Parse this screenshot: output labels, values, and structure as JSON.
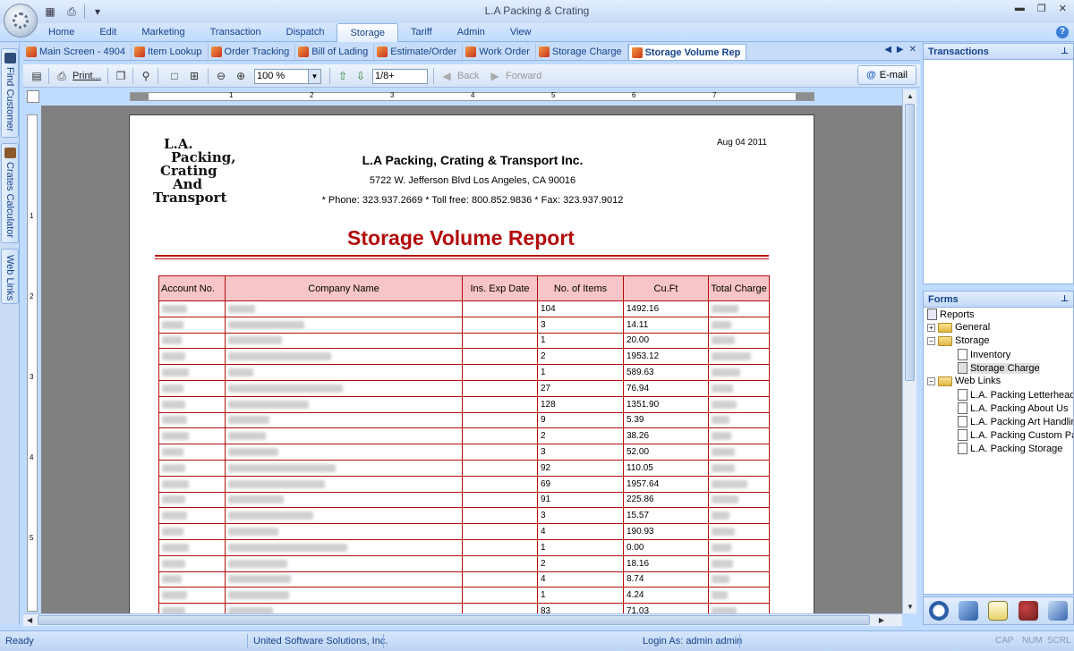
{
  "window": {
    "title": "L.A Packing & Crating"
  },
  "ribbon": {
    "tabs": [
      "Home",
      "Edit",
      "Marketing",
      "Transaction",
      "Dispatch",
      "Storage",
      "Tariff",
      "Admin",
      "View"
    ],
    "active": "Storage"
  },
  "left_bar": {
    "tabs": [
      "Find Customer",
      "Crates Calculator",
      "Web Links"
    ]
  },
  "doc_tabs": [
    "Main Screen - 4904",
    "Item Lookup",
    "Order Tracking",
    "Bill of Lading",
    "Estimate/Order",
    "Work Order",
    "Storage Charge",
    "Storage Volume Rep"
  ],
  "doc_tabs_active": "Storage Volume Rep",
  "toolbar": {
    "print_label": "Print...",
    "zoom_value": "100 %",
    "page_value": "1/8+",
    "back_label": "Back",
    "forward_label": "Forward",
    "email_label": "E-mail"
  },
  "ruler": {
    "numbers": [
      "1",
      "2",
      "3",
      "4",
      "5",
      "6",
      "7"
    ],
    "v_numbers": [
      "1",
      "2",
      "3",
      "4",
      "5"
    ]
  },
  "report": {
    "date": "Aug 04 2011",
    "logo_lines": [
      "L.A.",
      "Packing,",
      "Crating",
      "And",
      "Transport"
    ],
    "company_name": "L.A Packing, Crating & Transport Inc.",
    "address": "5722 W. Jefferson Blvd Los Angeles, CA 90016",
    "phones": "* Phone: 323.937.2669  * Toll free: 800.852.9836  * Fax: 323.937.9012",
    "title": "Storage Volume Report",
    "columns": [
      "Account No.",
      "Company Name",
      "Ins. Exp Date",
      "No. of Items",
      "Cu.Ft",
      "Total Charge"
    ],
    "rows": [
      {
        "items": "104",
        "cuft": "1492.16"
      },
      {
        "items": "3",
        "cuft": "14.11"
      },
      {
        "items": "1",
        "cuft": "20.00"
      },
      {
        "items": "2",
        "cuft": "1953.12"
      },
      {
        "items": "1",
        "cuft": "589.63"
      },
      {
        "items": "27",
        "cuft": "76.94"
      },
      {
        "items": "128",
        "cuft": "1351.90"
      },
      {
        "items": "9",
        "cuft": "5.39"
      },
      {
        "items": "2",
        "cuft": "38.26"
      },
      {
        "items": "3",
        "cuft": "52.00"
      },
      {
        "items": "92",
        "cuft": "110.05"
      },
      {
        "items": "69",
        "cuft": "1957.64"
      },
      {
        "items": "91",
        "cuft": "225.86"
      },
      {
        "items": "3",
        "cuft": "15.57"
      },
      {
        "items": "4",
        "cuft": "190.93"
      },
      {
        "items": "1",
        "cuft": "0.00"
      },
      {
        "items": "2",
        "cuft": "18.16"
      },
      {
        "items": "4",
        "cuft": "8.74"
      },
      {
        "items": "1",
        "cuft": "4.24"
      },
      {
        "items": "83",
        "cuft": "71.03"
      }
    ]
  },
  "transactions_panel": {
    "title": "Transactions"
  },
  "forms_panel": {
    "title": "Forms",
    "tree": {
      "root": "Reports",
      "general": "General",
      "storage": "Storage",
      "storage_items": [
        "Inventory",
        "Storage Charge"
      ],
      "web_links": "Web Links",
      "web_link_items": [
        "L.A. Packing Letterhead",
        "L.A. Packing About Us",
        "L.A. Packing Art Handling",
        "L.A. Packing Custom Packing",
        "L.A. Packing Storage"
      ]
    }
  },
  "status_bar": {
    "status": "Ready",
    "company": "United Software Solutions, Inc.",
    "login": "Login As: admin admin",
    "keys": [
      "CAP",
      "NUM",
      "SCRL"
    ]
  }
}
